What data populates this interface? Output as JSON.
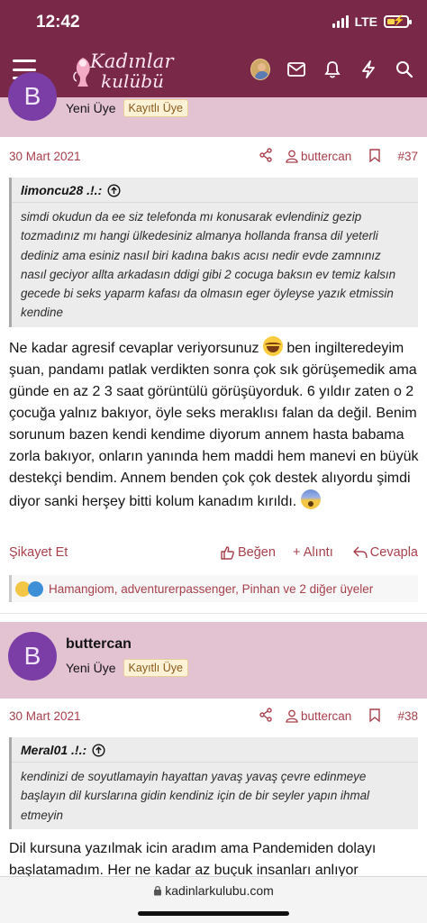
{
  "status_bar": {
    "time": "12:42",
    "network": "LTE"
  },
  "header": {
    "logo_line1": "Kadınlar",
    "logo_line2": "kulübü",
    "icons": [
      "menu-icon",
      "avatar",
      "mail-icon",
      "bell-icon",
      "bolt-icon",
      "search-icon"
    ]
  },
  "top_user": {
    "avatar_letter": "B",
    "role": "Yeni Üye",
    "badge": "Kayıtlı Üye"
  },
  "post1": {
    "date": "30 Mart 2021",
    "author": "buttercan",
    "number": "#37",
    "quote_author": "limoncu28 .!.:",
    "quote_text": "simdi okudun da ee siz telefonda mı konusarak evlendiniz gezip tozmadınız mı hangi ülkedesiniz almanya hollanda fransa dil yeterli dediniz ama esiniz nasıl biri kadına bakıs acısı nedir evde zamnınız nasıl geciyor allta arkadasın ddigi gibi 2 cocuga baksın ev temiz kalsın gecede bi seks yaparm kafası da olmasın eger öyleyse yazık etmissin kendine",
    "body_part1": "Ne kadar agresif cevaplar veriyorsunuz",
    "body_part2": "ben ingilteredeyim şuan, pandamı patlak verdikten sonra çok sık görüşemedik ama günde en az 2 3 saat görüntülü görüşüyorduk. 6 yıldır zaten o 2 çocuğa yalnız bakıyor, öyle seks meraklısı falan da değil. Benim sorunum bazen kendi kendime diyorum annem hasta babama zorla bakıyor, onların yanında hem maddi hem manevi en büyük destekçi bendim. Annem benden çok çok destek alıyordu şimdi diyor sanki herşey bitti kolum kanadım kırıldı.",
    "actions": {
      "report": "Şikayet Et",
      "like": "Beğen",
      "quote": "+ Alıntı",
      "reply": "Cevapla"
    },
    "reactions_text": "Hamangiom, adventurerpassenger, Pinhan ve 2 diğer üyeler"
  },
  "post2": {
    "avatar_letter": "B",
    "username": "buttercan",
    "role": "Yeni Üye",
    "badge": "Kayıtlı Üye",
    "date": "30 Mart 2021",
    "author": "buttercan",
    "number": "#38",
    "quote_author": "Meral01 .!.:",
    "quote_text": "kendinizi de soyutlamayin hayattan yavaş yavaş çevre edinmeye başlayın dil kurslarına gidin kendiniz için de bir seyler yapın ihmal etmeyin",
    "body_text": "Dil kursuna yazılmak icin aradım ama Pandemiden dolayı başlatamadım. Her ne kadar az buçuk insanları anlıyor"
  },
  "browser": {
    "url": "kadinlarkulubu.com"
  },
  "colors": {
    "brand": "#7a2848",
    "band": "#e3c2d2",
    "accent_text": "#a8404c",
    "avatar": "#7a3ea6"
  }
}
